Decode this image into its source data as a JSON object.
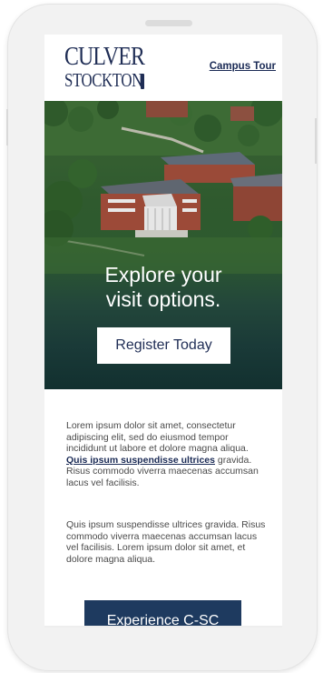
{
  "header": {
    "logo_line1": "CULVER",
    "logo_line2": "STOCKTON",
    "campus_tour_label": "Campus Tour"
  },
  "hero": {
    "title_line1": "Explore your",
    "title_line2": "visit options.",
    "register_label": "Register Today"
  },
  "content": {
    "paragraph1_before": "Lorem ipsum dolor sit amet, consectetur adipiscing elit, sed do eiusmod tempor incididunt ut labore et dolore magna aliqua. ",
    "paragraph1_link": "Quis ipsum suspendisse ultrices",
    "paragraph1_after": " gravida. Risus commodo viverra maecenas accumsan lacus vel facilisis.",
    "paragraph2": "Quis ipsum suspendisse ultrices gravida. Risus commodo viverra maecenas accumsan lacus vel facilisis. Lorem ipsum dolor sit amet, et dolore magna aliqua.",
    "cta_label": "Experience C-SC"
  },
  "colors": {
    "brand_navy": "#1f2d55",
    "cta_blue": "#1e3a5f",
    "hero_green": "#2d5a2f"
  }
}
